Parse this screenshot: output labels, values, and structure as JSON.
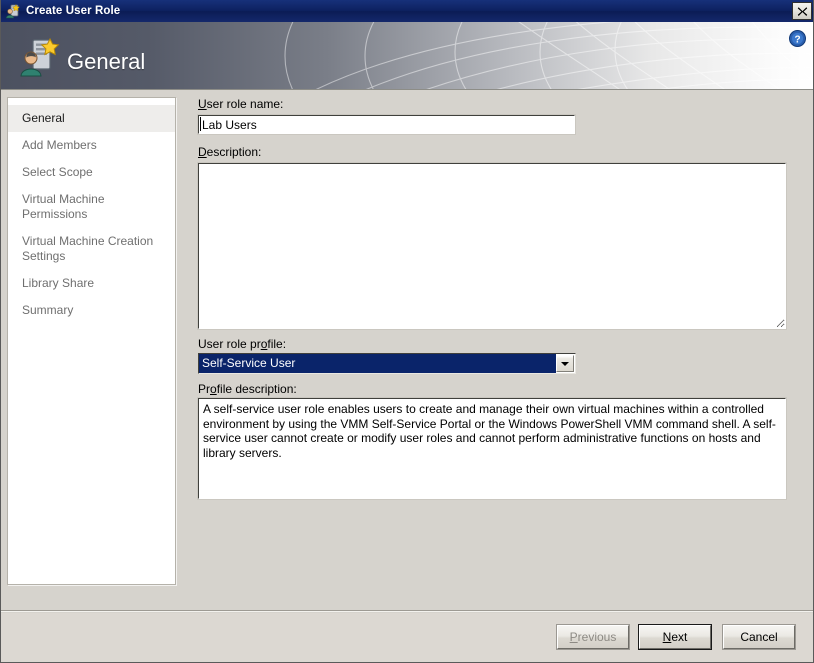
{
  "window": {
    "title": "Create User Role",
    "titlebar_icon": "user-role-icon",
    "close_label": "✕",
    "close_icon": "close-icon"
  },
  "header": {
    "title": "General",
    "icon": "server-user-star-icon",
    "help_icon": "help-question-icon",
    "help_label": "?"
  },
  "sidebar": {
    "items": [
      {
        "label": "General",
        "selected": true
      },
      {
        "label": "Add Members",
        "selected": false
      },
      {
        "label": "Select Scope",
        "selected": false
      },
      {
        "label": "Virtual Machine Permissions",
        "selected": false
      },
      {
        "label": "Virtual Machine Creation Settings",
        "selected": false
      },
      {
        "label": "Library Share",
        "selected": false
      },
      {
        "label": "Summary",
        "selected": false
      }
    ]
  },
  "form": {
    "role_name": {
      "label_pre": "",
      "label_acc": "U",
      "label_post": "ser role name:",
      "value": "Lab Users",
      "placeholder": ""
    },
    "description": {
      "label_pre": "",
      "label_acc": "D",
      "label_post": "escription:",
      "value": "",
      "placeholder": ""
    },
    "profile": {
      "label_pre": "User role pr",
      "label_acc": "o",
      "label_post": "file:",
      "selected": "Self-Service User",
      "options": [
        "Self-Service User"
      ]
    },
    "profile_description": {
      "label_pre": "Pr",
      "label_acc": "o",
      "label_post": "file description:",
      "text": "A self-service user role enables users to create and manage their own virtual machines within a controlled environment by using the VMM Self-Service Portal or the Windows PowerShell VMM command shell. A self-service user cannot create or modify user roles and cannot perform administrative functions on hosts and library servers."
    }
  },
  "footer": {
    "previous": {
      "label_pre": "",
      "label_acc": "P",
      "label_post": "revious",
      "disabled": true
    },
    "next": {
      "label_pre": "",
      "label_acc": "N",
      "label_post": "ext",
      "default": true
    },
    "cancel": {
      "label_pre": "Cancel",
      "label_acc": "",
      "label_post": "",
      "default": false
    }
  },
  "colors": {
    "titlebar": "#0d2160",
    "selection": "#0a246a",
    "dialog_bg": "#d6d3cd",
    "accent_help": "#1f5bbf"
  }
}
